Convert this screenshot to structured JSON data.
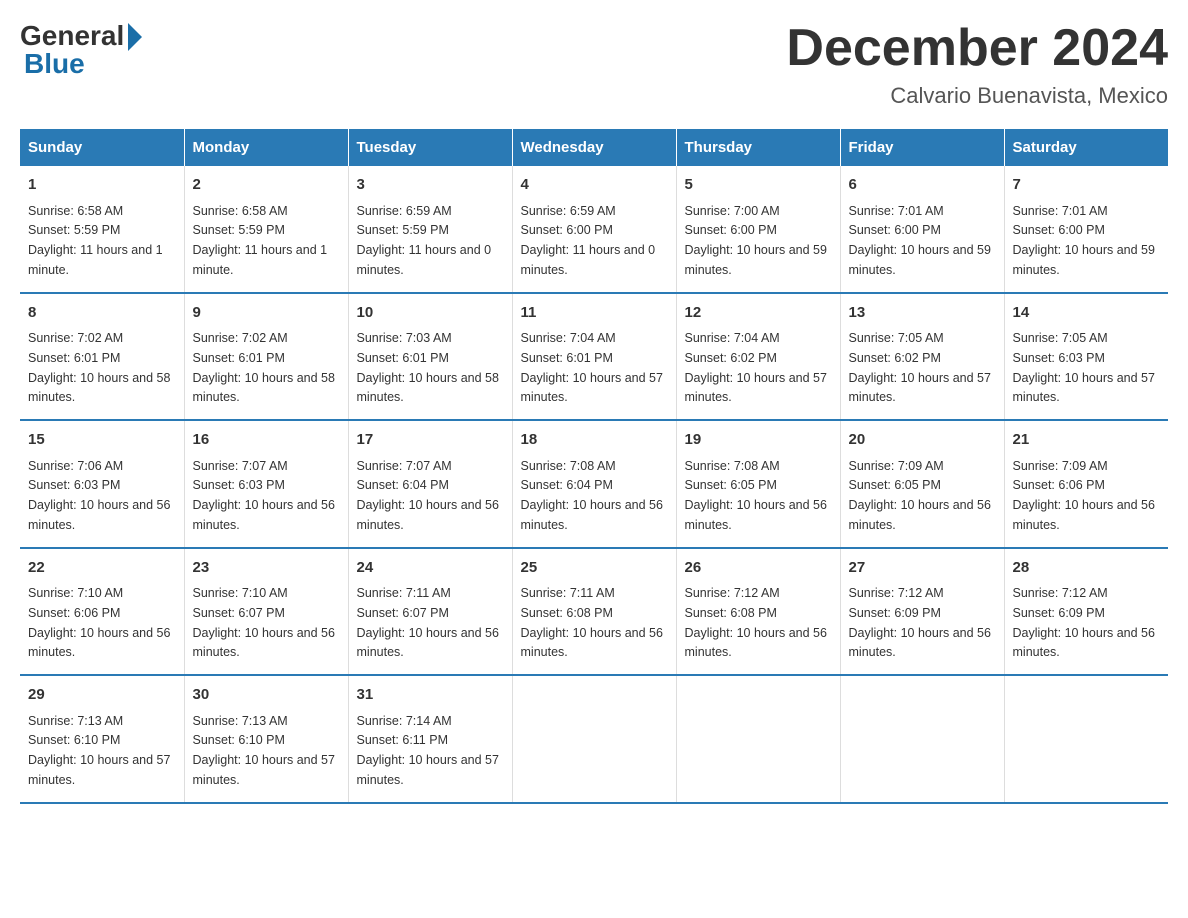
{
  "logo": {
    "general": "General",
    "blue": "Blue"
  },
  "title": "December 2024",
  "subtitle": "Calvario Buenavista, Mexico",
  "days_of_week": [
    "Sunday",
    "Monday",
    "Tuesday",
    "Wednesday",
    "Thursday",
    "Friday",
    "Saturday"
  ],
  "weeks": [
    [
      {
        "num": "1",
        "sunrise": "6:58 AM",
        "sunset": "5:59 PM",
        "daylight": "11 hours and 1 minute."
      },
      {
        "num": "2",
        "sunrise": "6:58 AM",
        "sunset": "5:59 PM",
        "daylight": "11 hours and 1 minute."
      },
      {
        "num": "3",
        "sunrise": "6:59 AM",
        "sunset": "5:59 PM",
        "daylight": "11 hours and 0 minutes."
      },
      {
        "num": "4",
        "sunrise": "6:59 AM",
        "sunset": "6:00 PM",
        "daylight": "11 hours and 0 minutes."
      },
      {
        "num": "5",
        "sunrise": "7:00 AM",
        "sunset": "6:00 PM",
        "daylight": "10 hours and 59 minutes."
      },
      {
        "num": "6",
        "sunrise": "7:01 AM",
        "sunset": "6:00 PM",
        "daylight": "10 hours and 59 minutes."
      },
      {
        "num": "7",
        "sunrise": "7:01 AM",
        "sunset": "6:00 PM",
        "daylight": "10 hours and 59 minutes."
      }
    ],
    [
      {
        "num": "8",
        "sunrise": "7:02 AM",
        "sunset": "6:01 PM",
        "daylight": "10 hours and 58 minutes."
      },
      {
        "num": "9",
        "sunrise": "7:02 AM",
        "sunset": "6:01 PM",
        "daylight": "10 hours and 58 minutes."
      },
      {
        "num": "10",
        "sunrise": "7:03 AM",
        "sunset": "6:01 PM",
        "daylight": "10 hours and 58 minutes."
      },
      {
        "num": "11",
        "sunrise": "7:04 AM",
        "sunset": "6:01 PM",
        "daylight": "10 hours and 57 minutes."
      },
      {
        "num": "12",
        "sunrise": "7:04 AM",
        "sunset": "6:02 PM",
        "daylight": "10 hours and 57 minutes."
      },
      {
        "num": "13",
        "sunrise": "7:05 AM",
        "sunset": "6:02 PM",
        "daylight": "10 hours and 57 minutes."
      },
      {
        "num": "14",
        "sunrise": "7:05 AM",
        "sunset": "6:03 PM",
        "daylight": "10 hours and 57 minutes."
      }
    ],
    [
      {
        "num": "15",
        "sunrise": "7:06 AM",
        "sunset": "6:03 PM",
        "daylight": "10 hours and 56 minutes."
      },
      {
        "num": "16",
        "sunrise": "7:07 AM",
        "sunset": "6:03 PM",
        "daylight": "10 hours and 56 minutes."
      },
      {
        "num": "17",
        "sunrise": "7:07 AM",
        "sunset": "6:04 PM",
        "daylight": "10 hours and 56 minutes."
      },
      {
        "num": "18",
        "sunrise": "7:08 AM",
        "sunset": "6:04 PM",
        "daylight": "10 hours and 56 minutes."
      },
      {
        "num": "19",
        "sunrise": "7:08 AM",
        "sunset": "6:05 PM",
        "daylight": "10 hours and 56 minutes."
      },
      {
        "num": "20",
        "sunrise": "7:09 AM",
        "sunset": "6:05 PM",
        "daylight": "10 hours and 56 minutes."
      },
      {
        "num": "21",
        "sunrise": "7:09 AM",
        "sunset": "6:06 PM",
        "daylight": "10 hours and 56 minutes."
      }
    ],
    [
      {
        "num": "22",
        "sunrise": "7:10 AM",
        "sunset": "6:06 PM",
        "daylight": "10 hours and 56 minutes."
      },
      {
        "num": "23",
        "sunrise": "7:10 AM",
        "sunset": "6:07 PM",
        "daylight": "10 hours and 56 minutes."
      },
      {
        "num": "24",
        "sunrise": "7:11 AM",
        "sunset": "6:07 PM",
        "daylight": "10 hours and 56 minutes."
      },
      {
        "num": "25",
        "sunrise": "7:11 AM",
        "sunset": "6:08 PM",
        "daylight": "10 hours and 56 minutes."
      },
      {
        "num": "26",
        "sunrise": "7:12 AM",
        "sunset": "6:08 PM",
        "daylight": "10 hours and 56 minutes."
      },
      {
        "num": "27",
        "sunrise": "7:12 AM",
        "sunset": "6:09 PM",
        "daylight": "10 hours and 56 minutes."
      },
      {
        "num": "28",
        "sunrise": "7:12 AM",
        "sunset": "6:09 PM",
        "daylight": "10 hours and 56 minutes."
      }
    ],
    [
      {
        "num": "29",
        "sunrise": "7:13 AM",
        "sunset": "6:10 PM",
        "daylight": "10 hours and 57 minutes."
      },
      {
        "num": "30",
        "sunrise": "7:13 AM",
        "sunset": "6:10 PM",
        "daylight": "10 hours and 57 minutes."
      },
      {
        "num": "31",
        "sunrise": "7:14 AM",
        "sunset": "6:11 PM",
        "daylight": "10 hours and 57 minutes."
      },
      null,
      null,
      null,
      null
    ]
  ],
  "sunrise_label": "Sunrise:",
  "sunset_label": "Sunset:",
  "daylight_label": "Daylight:"
}
